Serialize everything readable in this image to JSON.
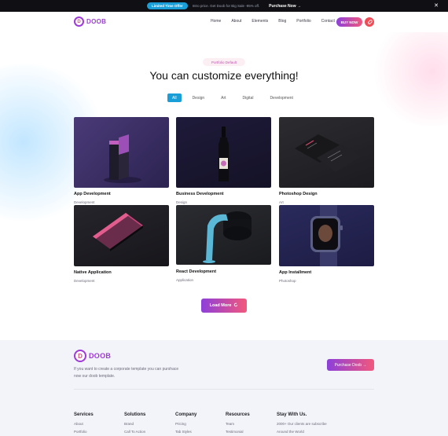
{
  "promo": {
    "badge": "Limited Time Offer",
    "message": "Intro price. Get Doob for Big Sale -95% off.",
    "cta": "Purchase Now",
    "cta_arrow": "→",
    "close": "✕"
  },
  "header": {
    "logo_letter": "D",
    "logo_text": "DOOB",
    "nav": [
      "Home",
      "About",
      "Elements",
      "Blog",
      "Portfolio",
      "Contact"
    ],
    "buy_label": "BUY NOW"
  },
  "main": {
    "eyebrow": "Portfolio Default",
    "title": "You can customize everything!",
    "filters": [
      "All",
      "Design",
      "Art",
      "Digital",
      "Development"
    ],
    "active_filter": "All",
    "cards": [
      {
        "title": "App Development",
        "category": "Development"
      },
      {
        "title": "Business Development",
        "category": "Design"
      },
      {
        "title": "Photoshop Design",
        "category": "Art"
      },
      {
        "title": "Native Application",
        "category": "Development"
      },
      {
        "title": "React Development",
        "category": "Application"
      },
      {
        "title": "App Installment",
        "category": "Photoshop"
      }
    ],
    "load_more": "Load More",
    "load_more_icon": "refresh-icon"
  },
  "footer": {
    "logo_letter": "D",
    "logo_text": "DOOB",
    "description": "If you want to create a corporate template you can purshace now our doob template.",
    "button_label": "Purchase Doob →",
    "columns": [
      {
        "title": "Services",
        "items": [
          "About",
          "Portfolio"
        ]
      },
      {
        "title": "Solutions",
        "items": [
          "Brand",
          "Call To Action"
        ]
      },
      {
        "title": "Company",
        "items": [
          "Pricing",
          "Tab Styles"
        ]
      },
      {
        "title": "Resources",
        "items": [
          "Team",
          "Testimonial"
        ]
      },
      {
        "title": "Stay With Us.",
        "items": [
          "2000+ Our clients are subscribe",
          "Around the World"
        ]
      }
    ]
  },
  "colors": {
    "accent_blue": "#1a9ed8",
    "gradient_start": "#8d3fda",
    "gradient_end": "#f2587b"
  }
}
